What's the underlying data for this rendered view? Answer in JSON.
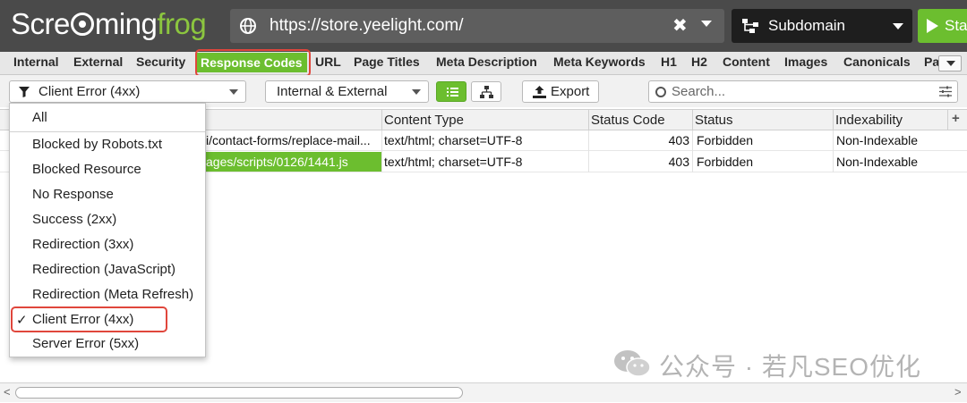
{
  "app": {
    "logo_left": "Scre",
    "logo_mid": "ming",
    "logo_right": "frog"
  },
  "topbar": {
    "url": "https://store.yeelight.com/",
    "clear_symbol": "✖",
    "mode_label": "Subdomain",
    "start_label": "Sta"
  },
  "tabs": [
    {
      "label": "Internal"
    },
    {
      "label": "External"
    },
    {
      "label": "Security"
    },
    {
      "label": "Response Codes",
      "active": true
    },
    {
      "label": "URL"
    },
    {
      "label": "Page Titles"
    },
    {
      "label": "Meta Description"
    },
    {
      "label": "Meta Keywords"
    },
    {
      "label": "H1"
    },
    {
      "label": "H2"
    },
    {
      "label": "Content"
    },
    {
      "label": "Images"
    },
    {
      "label": "Canonicals"
    },
    {
      "label": "Pa"
    }
  ],
  "filterbar": {
    "filter_selected": "Client Error (4xx)",
    "scope_selected": "Internal & External",
    "export_label": "Export",
    "search_placeholder": "Search..."
  },
  "table": {
    "columns": [
      "Content Type",
      "Status Code",
      "Status",
      "Indexability"
    ],
    "rows": [
      {
        "address": "i/contact-forms/replace-mail...",
        "content_type": "text/html; charset=UTF-8",
        "status_code": "403",
        "status": "Forbidden",
        "indexability": "Non-Indexable"
      },
      {
        "address": "ages/scripts/0126/1441.js",
        "content_type": "text/html; charset=UTF-8",
        "status_code": "403",
        "status": "Forbidden",
        "indexability": "Non-Indexable"
      }
    ]
  },
  "filter_menu": {
    "items": [
      {
        "label": "All"
      },
      {
        "label": "Blocked by Robots.txt"
      },
      {
        "label": "Blocked Resource"
      },
      {
        "label": "No Response"
      },
      {
        "label": "Success (2xx)"
      },
      {
        "label": "Redirection (3xx)"
      },
      {
        "label": "Redirection (JavaScript)"
      },
      {
        "label": "Redirection (Meta Refresh)"
      },
      {
        "label": "Client Error (4xx)",
        "checked": true
      },
      {
        "label": "Server Error (5xx)"
      }
    ],
    "check_mark": "✓"
  },
  "watermark": {
    "text": "公众号 · 若凡SEO优化"
  },
  "colors": {
    "accent_green": "#6cbe2f",
    "highlight_red": "#e0463c",
    "topbar_bg": "#4a4a4a"
  }
}
